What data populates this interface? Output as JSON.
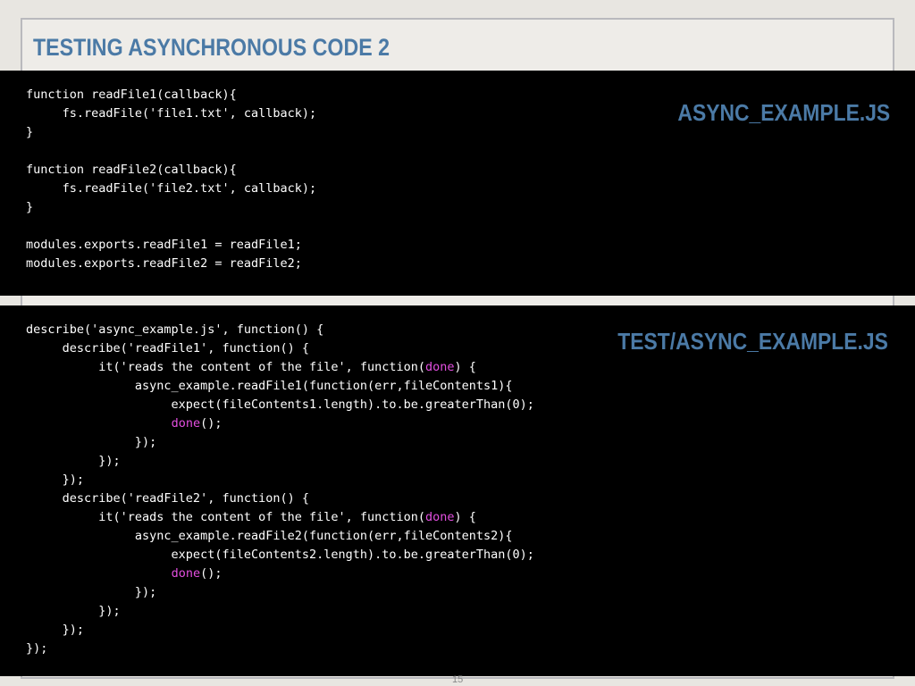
{
  "slide": {
    "title": "TESTING ASYNCHRONOUS CODE 2",
    "page_number": "15"
  },
  "panel1": {
    "file_label": "ASYNC_EXAMPLE.JS",
    "lines": [
      "function readFile1(callback){",
      "     fs.readFile('file1.txt', callback);",
      "}",
      "",
      "function readFile2(callback){",
      "     fs.readFile('file2.txt', callback);",
      "}",
      "",
      "modules.exports.readFile1 = readFile1;",
      "modules.exports.readFile2 = readFile2;"
    ]
  },
  "panel2": {
    "file_label": "TEST/ASYNC_EXAMPLE.JS",
    "highlight_word": "done",
    "highlight_color": "#e34fe0",
    "lines": [
      "describe('async_example.js', function() {",
      "     describe('readFile1', function() {",
      "          it('reads the content of the file', function(done) {",
      "               async_example.readFile1(function(err,fileContents1){",
      "                    expect(fileContents1.length).to.be.greaterThan(0);",
      "                    done();",
      "               });",
      "          });",
      "     });",
      "     describe('readFile2', function() {",
      "          it('reads the content of the file', function(done) {",
      "               async_example.readFile2(function(err,fileContents2){",
      "                    expect(fileContents2.length).to.be.greaterThan(0);",
      "                    done();",
      "               });",
      "          });",
      "     });",
      "});"
    ]
  },
  "colors": {
    "title": "#4b7aa6",
    "code_background": "#000000",
    "code_text": "#ffffff"
  }
}
